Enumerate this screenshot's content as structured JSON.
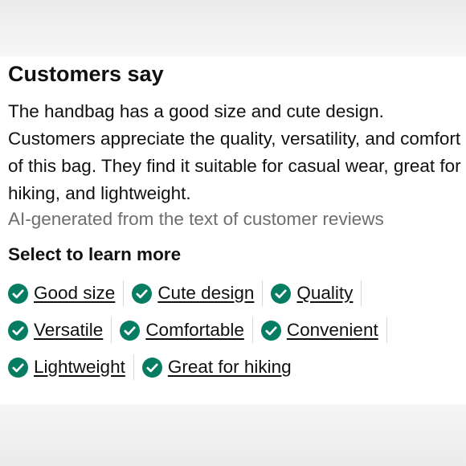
{
  "review_summary": {
    "heading": "Customers say",
    "summary": "The handbag has a good size and cute design. Customers appreciate the quality, versatility, and comfort of this bag. They find it suitable for casual wear, great for hiking, and lightweight.",
    "ai_note": "AI-generated from the text of customer reviews",
    "select_heading": "Select to learn more",
    "check_color": "#067d62",
    "aspects": [
      {
        "label": "Good size"
      },
      {
        "label": "Cute design"
      },
      {
        "label": "Quality"
      },
      {
        "label": "Versatile"
      },
      {
        "label": "Comfortable"
      },
      {
        "label": "Convenient"
      },
      {
        "label": "Lightweight"
      },
      {
        "label": "Great for hiking"
      }
    ]
  }
}
